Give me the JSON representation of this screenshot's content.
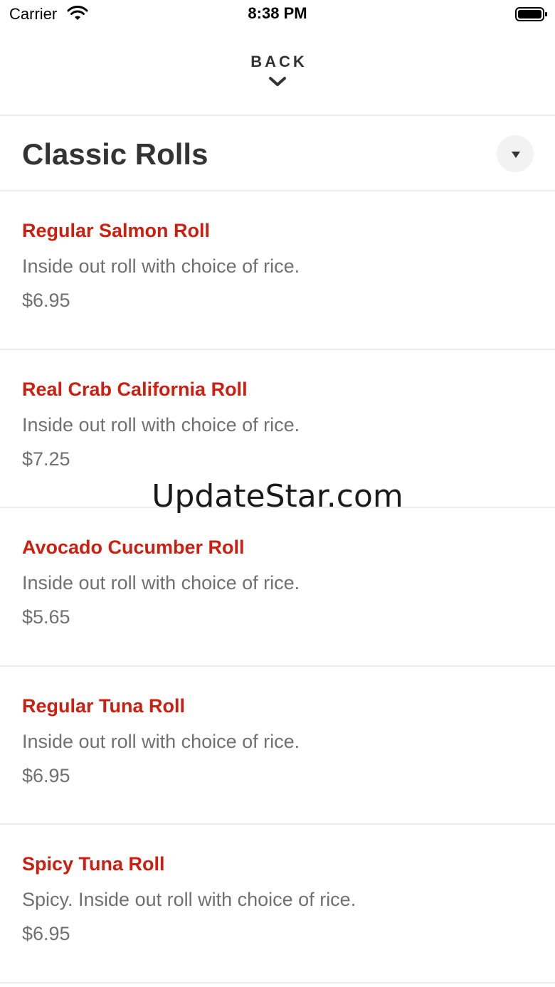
{
  "status_bar": {
    "carrier": "Carrier",
    "time": "8:38 PM"
  },
  "header": {
    "back_label": "BACK"
  },
  "category": {
    "title": "Classic Rolls"
  },
  "menu_items": [
    {
      "name": "Regular Salmon Roll",
      "description": "Inside out roll with choice of rice.",
      "price": "$6.95"
    },
    {
      "name": "Real Crab California Roll",
      "description": "Inside out roll with choice of rice.",
      "price": "$7.25"
    },
    {
      "name": "Avocado Cucumber Roll",
      "description": "Inside out roll with choice of rice.",
      "price": "$5.65"
    },
    {
      "name": "Regular Tuna Roll",
      "description": "Inside out roll with choice of rice.",
      "price": "$6.95"
    },
    {
      "name": "Spicy Tuna Roll",
      "description": "Spicy. Inside out roll with choice of rice.",
      "price": "$6.95"
    }
  ],
  "watermark": "UpdateStar.com",
  "colors": {
    "accent": "#cc1f0f",
    "text": "#333333",
    "muted": "#707070",
    "divider": "#ececec"
  },
  "icons": [
    "wifi-icon",
    "battery-icon",
    "chevron-down-icon",
    "triangle-down-icon"
  ]
}
